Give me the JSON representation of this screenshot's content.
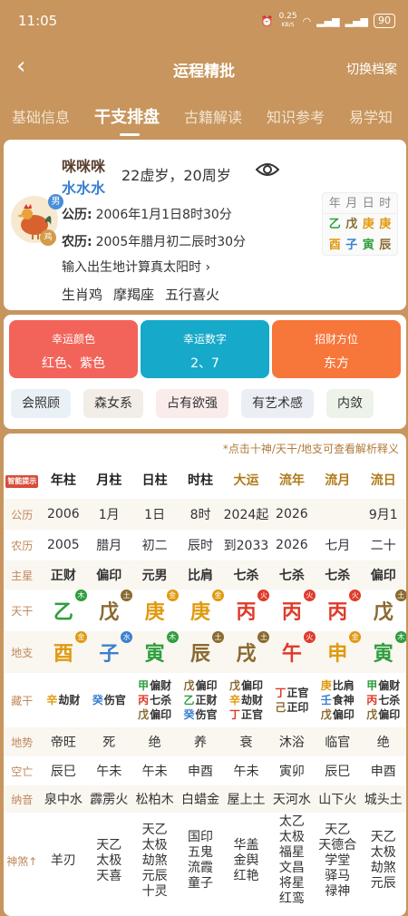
{
  "status": {
    "time": "11:05",
    "speed": "0.25",
    "speed_unit": "KB/S",
    "battery": "90"
  },
  "nav": {
    "back": "‹",
    "title": "运程精批",
    "switch": "切换档案"
  },
  "tabs": [
    "基础信息",
    "干支排盘",
    "古籍解读",
    "知识参考",
    "易学知"
  ],
  "profile": {
    "name1": "咪咪咪",
    "name2": "水水水",
    "ages": "22虚岁，20周岁",
    "sex": "男",
    "zodiac": "鸡",
    "solar_label": "公历:",
    "solar_value": "2006年1月1日8时30分",
    "lunar_label": "农历:",
    "lunar_value": "2005年腊月初二辰时30分",
    "true_solar": "输入出生地计算真太阳时 ›",
    "traits": [
      "生肖鸡",
      "摩羯座",
      "五行喜火"
    ],
    "mini_header": [
      "年",
      "月",
      "日",
      "时"
    ],
    "mini_gan": [
      {
        "c": "乙",
        "col": "#2e9e3e"
      },
      {
        "c": "戊",
        "col": "#8a6a30"
      },
      {
        "c": "庚",
        "col": "#e09a10"
      },
      {
        "c": "庚",
        "col": "#e09a10"
      }
    ],
    "mini_zhi": [
      {
        "c": "酉",
        "col": "#e09a10"
      },
      {
        "c": "子",
        "col": "#3a7fd0"
      },
      {
        "c": "寅",
        "col": "#2e9e3e"
      },
      {
        "c": "辰",
        "col": "#8a6a30"
      }
    ]
  },
  "lucky": {
    "color_title": "幸运颜色",
    "color_value": "红色、紫色",
    "number_title": "幸运数字",
    "number_value": "2、7",
    "direction_title": "招财方位",
    "direction_value": "东方"
  },
  "chips": [
    "会照顾",
    "森女系",
    "占有欲强",
    "有艺术感",
    "内敛"
  ],
  "chart": {
    "hint": "*点击十神/天干/地支可查看解析释义",
    "smart": "智能提示",
    "columns": [
      "年柱",
      "月柱",
      "日柱",
      "时柱",
      "大运",
      "流年",
      "流月",
      "流日"
    ],
    "labels": {
      "solar": "公历",
      "lunar": "农历",
      "star": "主星",
      "gan": "天干",
      "zhi": "地支",
      "hidden": "藏干",
      "state": "地势",
      "void": "空亡",
      "nayin": "纳音",
      "shensha": "神煞↑"
    },
    "solar": [
      "2006",
      "1月",
      "1日",
      "8时",
      "2024起",
      "2026",
      "",
      "9月1"
    ],
    "lunar": [
      "2005",
      "腊月",
      "初二",
      "辰时",
      "到2033",
      "2026",
      "七月",
      "二十"
    ],
    "star": [
      "正财",
      "偏印",
      "元男",
      "比肩",
      "七杀",
      "七杀",
      "七杀",
      "偏印"
    ],
    "gan": [
      {
        "c": "乙",
        "col": "#2e9e3e",
        "e": "木",
        "ec": "#2e9e3e"
      },
      {
        "c": "戊",
        "col": "#8a6a30",
        "e": "土",
        "ec": "#8a6a30"
      },
      {
        "c": "庚",
        "col": "#e09a10",
        "e": "金",
        "ec": "#e09a10"
      },
      {
        "c": "庚",
        "col": "#e09a10",
        "e": "金",
        "ec": "#e09a10"
      },
      {
        "c": "丙",
        "col": "#e03a2a",
        "e": "火",
        "ec": "#e03a2a"
      },
      {
        "c": "丙",
        "col": "#e03a2a",
        "e": "火",
        "ec": "#e03a2a"
      },
      {
        "c": "丙",
        "col": "#e03a2a",
        "e": "火",
        "ec": "#e03a2a"
      },
      {
        "c": "戊",
        "col": "#8a6a30",
        "e": "土",
        "ec": "#8a6a30"
      }
    ],
    "zhi": [
      {
        "c": "酉",
        "col": "#e09a10",
        "e": "金",
        "ec": "#e09a10"
      },
      {
        "c": "子",
        "col": "#3a7fd0",
        "e": "水",
        "ec": "#3a7fd0"
      },
      {
        "c": "寅",
        "col": "#2e9e3e",
        "e": "木",
        "ec": "#2e9e3e"
      },
      {
        "c": "辰",
        "col": "#8a6a30",
        "e": "土",
        "ec": "#8a6a30"
      },
      {
        "c": "戌",
        "col": "#8a6a30",
        "e": "土",
        "ec": "#8a6a30"
      },
      {
        "c": "午",
        "col": "#e03a2a",
        "e": "火",
        "ec": "#e03a2a"
      },
      {
        "c": "申",
        "col": "#e09a10",
        "e": "金",
        "ec": "#e09a10"
      },
      {
        "c": "寅",
        "col": "#2e9e3e",
        "e": "木",
        "ec": "#2e9e3e"
      }
    ],
    "hidden": [
      [
        {
          "g": "辛",
          "gc": "#e09a10",
          "s": "劫财"
        }
      ],
      [
        {
          "g": "癸",
          "gc": "#3a7fd0",
          "s": "伤官"
        }
      ],
      [
        {
          "g": "甲",
          "gc": "#2e9e3e",
          "s": "偏财"
        },
        {
          "g": "丙",
          "gc": "#e03a2a",
          "s": "七杀"
        },
        {
          "g": "戊",
          "gc": "#8a6a30",
          "s": "偏印"
        }
      ],
      [
        {
          "g": "戊",
          "gc": "#8a6a30",
          "s": "偏印"
        },
        {
          "g": "乙",
          "gc": "#2e9e3e",
          "s": "正财"
        },
        {
          "g": "癸",
          "gc": "#3a7fd0",
          "s": "伤官"
        }
      ],
      [
        {
          "g": "戊",
          "gc": "#8a6a30",
          "s": "偏印"
        },
        {
          "g": "辛",
          "gc": "#e09a10",
          "s": "劫财"
        },
        {
          "g": "丁",
          "gc": "#e03a2a",
          "s": "正官"
        }
      ],
      [
        {
          "g": "丁",
          "gc": "#e03a2a",
          "s": "正官"
        },
        {
          "g": "己",
          "gc": "#8a6a30",
          "s": "正印"
        }
      ],
      [
        {
          "g": "庚",
          "gc": "#e09a10",
          "s": "比肩"
        },
        {
          "g": "壬",
          "gc": "#3a7fd0",
          "s": "食神"
        },
        {
          "g": "戊",
          "gc": "#8a6a30",
          "s": "偏印"
        }
      ],
      [
        {
          "g": "甲",
          "gc": "#2e9e3e",
          "s": "偏财"
        },
        {
          "g": "丙",
          "gc": "#e03a2a",
          "s": "七杀"
        },
        {
          "g": "戊",
          "gc": "#8a6a30",
          "s": "偏印"
        }
      ]
    ],
    "state": [
      "帝旺",
      "死",
      "绝",
      "养",
      "衰",
      "沐浴",
      "临官",
      "绝"
    ],
    "void": [
      "辰巳",
      "午未",
      "午未",
      "申酉",
      "午未",
      "寅卯",
      "辰巳",
      "申酉"
    ],
    "nayin": [
      "泉中水",
      "霹雳火",
      "松柏木",
      "白蜡金",
      "屋上土",
      "天河水",
      "山下火",
      "城头土"
    ],
    "shensha": [
      [
        "羊刃"
      ],
      [
        "天乙",
        "太极",
        "天喜"
      ],
      [
        "天乙",
        "太极",
        "劫煞",
        "元辰",
        "十灵"
      ],
      [
        "国印",
        "五鬼",
        "流霞",
        "童子"
      ],
      [
        "华盖",
        "金舆",
        "红艳"
      ],
      [
        "太乙",
        "太极",
        "福星",
        "文昌",
        "将星",
        "红鸾"
      ],
      [
        "天乙",
        "天德合",
        "学堂",
        "驿马",
        "禄神"
      ],
      [
        "天乙",
        "太极",
        "劫煞",
        "元辰"
      ]
    ]
  }
}
